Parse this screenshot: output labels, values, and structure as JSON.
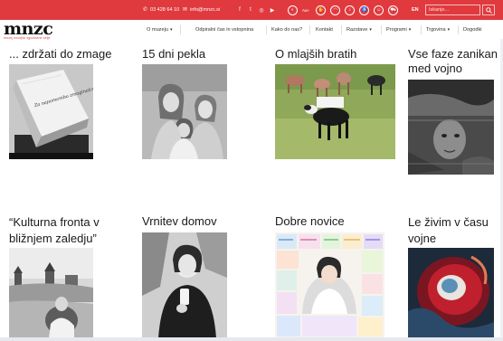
{
  "contact": {
    "phone": "03 428 64 10",
    "email": "info@mnzc.si"
  },
  "icons": {
    "phone": "phone-icon",
    "mail": "mail-icon",
    "social": [
      "facebook-icon",
      "twitter-icon",
      "instagram-icon",
      "youtube-icon"
    ],
    "accessibility": [
      "contrast-icon",
      "font-size-icon",
      "sign-language-icon",
      "wifi-icon",
      "audio-icon",
      "wheelchair-icon",
      "baby-icon",
      "cart-icon"
    ]
  },
  "accessibility": {
    "aa_label": "Aa+"
  },
  "language": "EN",
  "search": {
    "placeholder": "Iskanje..."
  },
  "logo": {
    "text": "mnzc",
    "subtitle": "muzej novejše zgodovine celje"
  },
  "nav": {
    "items": [
      {
        "label": "O muzeju",
        "dropdown": true
      },
      {
        "label": "Odpiralni čas in vstopnina",
        "dropdown": false
      },
      {
        "label": "Kako do nas?",
        "dropdown": false
      },
      {
        "label": "Kontakt",
        "dropdown": false
      },
      {
        "label": "Razstave",
        "dropdown": true
      },
      {
        "label": "Programi",
        "dropdown": true
      },
      {
        "label": "Trgovina",
        "dropdown": true
      },
      {
        "label": "Dogodki",
        "dropdown": false
      }
    ]
  },
  "cards": [
    {
      "title": "... zdržati do zmage",
      "image_text": "Za napomembo zmaginalcem"
    },
    {
      "title": "15 dni pekla"
    },
    {
      "title": "O mlajših bratih"
    },
    {
      "title": "Vse faze zanikan med vojno"
    },
    {
      "title": "“Kulturna fronta v bližnjem zaledju”"
    },
    {
      "title": "Vrnitev domov"
    },
    {
      "title": "Dobre novice"
    },
    {
      "title": "Le živim v času vojne"
    }
  ],
  "colors": {
    "brand_red": "#e03a3e",
    "text_dark": "#1a1a1a"
  }
}
